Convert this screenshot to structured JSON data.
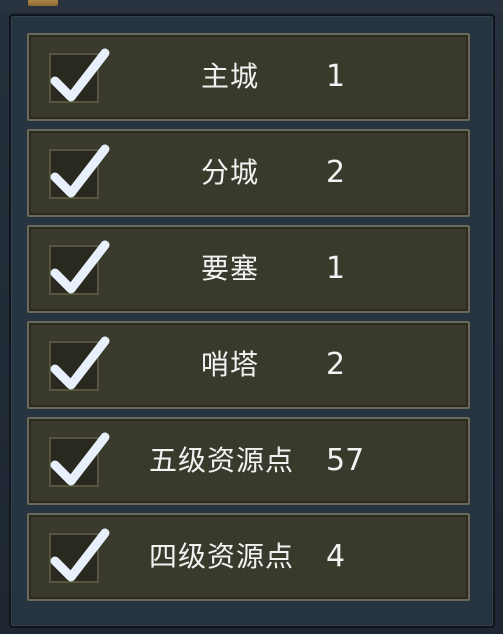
{
  "filters": [
    {
      "name": "主城",
      "count": "1",
      "checked": true
    },
    {
      "name": "分城",
      "count": "2",
      "checked": true
    },
    {
      "name": "要塞",
      "count": "1",
      "checked": true
    },
    {
      "name": "哨塔",
      "count": "2",
      "checked": true
    },
    {
      "name": "五级资源点",
      "count": "57",
      "checked": true
    },
    {
      "name": "四级资源点",
      "count": "4",
      "checked": true
    }
  ],
  "colors": {
    "panel_bg": "#263341",
    "row_bg": "#3a3a2c",
    "row_border": "#6b6a58",
    "check_color": "#e8f0fb",
    "text_color": "#f2f2f2"
  },
  "icons": {
    "top_icon": "chest-icon",
    "check_icon": "checkmark-icon"
  }
}
